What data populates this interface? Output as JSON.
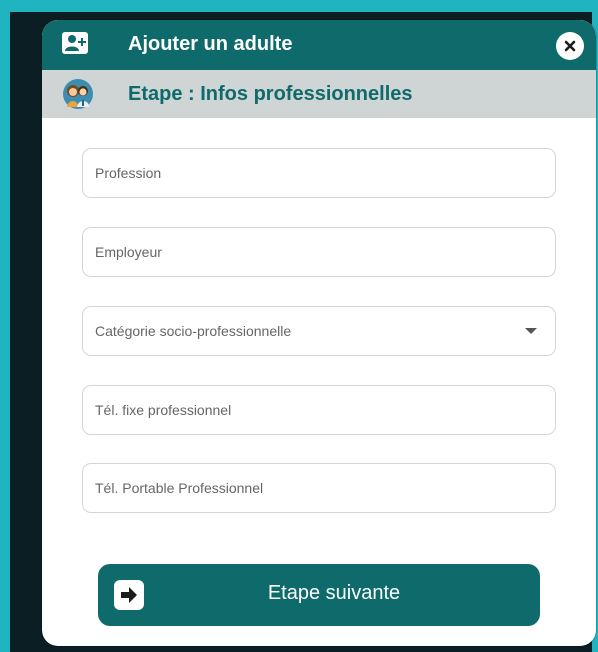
{
  "dialog": {
    "title": "Ajouter un adulte",
    "header_icon": "add-user-icon",
    "close_icon": "close-icon"
  },
  "step": {
    "title": "Etape : Infos professionnelles",
    "icon": "people-avatar-icon"
  },
  "form": {
    "profession": {
      "placeholder": "Profession",
      "value": ""
    },
    "employeur": {
      "placeholder": "Employeur",
      "value": ""
    },
    "categorie": {
      "label": "Catégorie socio-professionnelle"
    },
    "tel_fixe": {
      "placeholder": "Tél. fixe professionnel",
      "value": ""
    },
    "tel_portable": {
      "placeholder": "Tél. Portable Professionnel",
      "value": ""
    }
  },
  "actions": {
    "next_label": "Etape suivante",
    "next_icon": "arrow-right-icon"
  },
  "colors": {
    "page_background": "#20b3c0",
    "primary": "#0f6b6b",
    "step_bar": "#cfd4d4",
    "backdrop": "#0a1e24"
  }
}
